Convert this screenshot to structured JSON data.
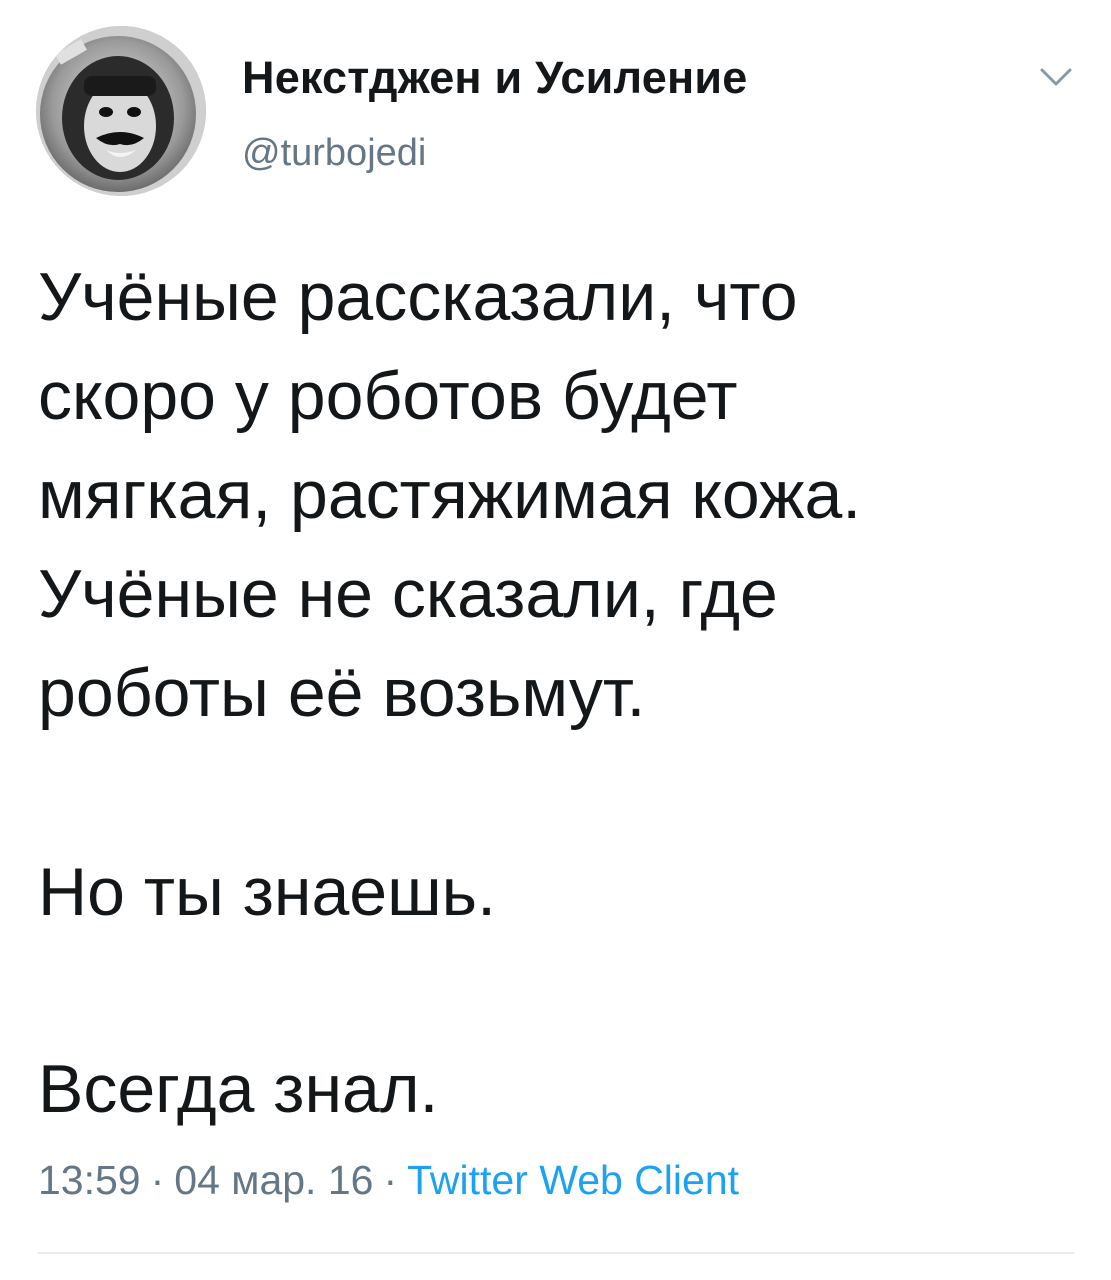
{
  "tweet": {
    "display_name": "Некстджен и Усиление",
    "handle": "@turbojedi",
    "paragraphs": [
      [
        "Учёные рассказали, что",
        "скоро у роботов будет",
        "мягкая, растяжимая кожа.",
        "Учёные не сказали, где",
        "роботы её возьмут."
      ],
      [
        "Но ты знаешь."
      ],
      [
        "Всегда знал."
      ]
    ],
    "time": "13:59",
    "date": "04 мар. 16",
    "separator": "·",
    "source": "Twitter Web Client",
    "menu_icon": "chevron-down-icon",
    "avatar_icon": "avatar"
  },
  "colors": {
    "text": "#14171a",
    "secondary": "#657786",
    "link": "#1da1f2",
    "divider": "#e6ecf0"
  }
}
